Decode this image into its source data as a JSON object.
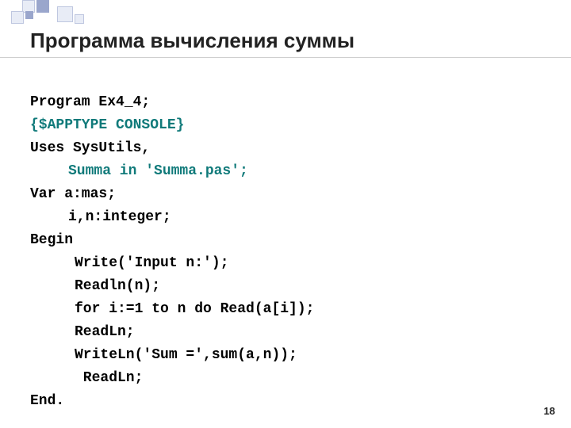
{
  "slide": {
    "title": "Программа вычисления суммы",
    "page_number": "18"
  },
  "code": {
    "l1": "Program Ex4_4;",
    "l2": "{$APPTYPE CONSOLE}",
    "l3": "Uses SysUtils,",
    "l4": "Summa in 'Summa.pas';",
    "l5": "Var a:mas;",
    "l6": "i,n:integer;",
    "l7": "Begin",
    "l8": "Write('Input n:');",
    "l9": "Readln(n);",
    "l10": "for i:=1 to n do Read(a[i]);",
    "l11": "ReadLn;",
    "l12": "WriteLn('Sum =',sum(a,n));",
    "l13": " ReadLn;",
    "l14": "End."
  }
}
